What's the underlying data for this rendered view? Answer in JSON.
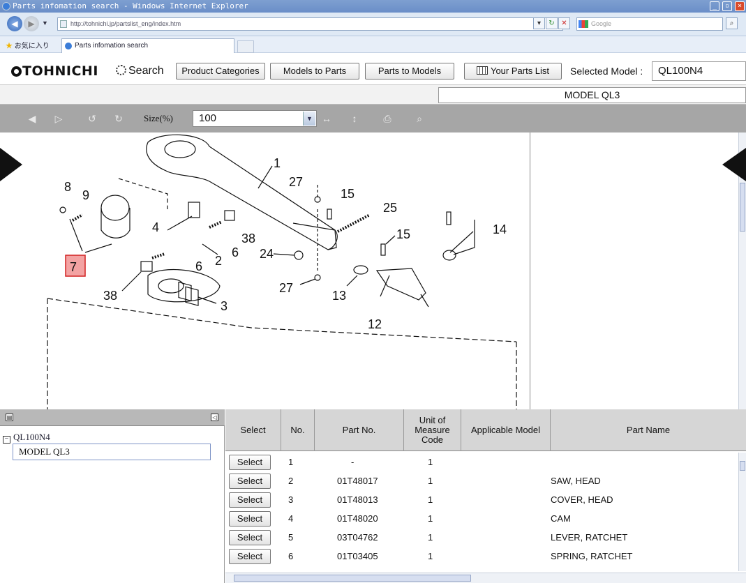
{
  "browser": {
    "window_title": "Parts infomation search - Windows Internet Explorer",
    "url": "http://tohnichi.jp/partslist_eng/index.htm",
    "search_engine": "Google",
    "favorites_label": "お気に入り",
    "tab_title": "Parts infomation search"
  },
  "header": {
    "logo": "TOHNICHI",
    "search_label": "Search",
    "buttons": {
      "product_categories": "Product Categories",
      "models_to_parts": "Models to Parts",
      "parts_to_models": "Parts to Models",
      "your_parts_list": "Your Parts List"
    },
    "selected_model_label": "Selected Model :",
    "selected_model_value": "QL100N4",
    "model_title": "MODEL QL3"
  },
  "viewer": {
    "size_label": "Size(%)",
    "size_value": "100",
    "part_labels": {
      "p1": "1",
      "p2": "2",
      "p3": "3",
      "p4": "4",
      "p6a": "6",
      "p6b": "6",
      "p7": "7",
      "p8": "8",
      "p9": "9",
      "p12": "12",
      "p13": "13",
      "p14": "14",
      "p15a": "15",
      "p15b": "15",
      "p24": "24",
      "p25": "25",
      "p27a": "27",
      "p27b": "27",
      "p38a": "38",
      "p38b": "38"
    },
    "highlighted_part": "7"
  },
  "tree": {
    "root": "QL100N4",
    "child": "MODEL QL3"
  },
  "chart_data": {
    "type": "table",
    "columns": [
      "Select",
      "No.",
      "Part No.",
      "Unit of Measure Code",
      "Applicable Model",
      "Part Name"
    ],
    "rows": [
      {
        "select": "Select",
        "no": "1",
        "part_no": "-",
        "uom": "1",
        "model": "",
        "name": ""
      },
      {
        "select": "Select",
        "no": "2",
        "part_no": "01T48017",
        "uom": "1",
        "model": "",
        "name": "SAW, HEAD"
      },
      {
        "select": "Select",
        "no": "3",
        "part_no": "01T48013",
        "uom": "1",
        "model": "",
        "name": "COVER, HEAD"
      },
      {
        "select": "Select",
        "no": "4",
        "part_no": "01T48020",
        "uom": "1",
        "model": "",
        "name": "CAM"
      },
      {
        "select": "Select",
        "no": "5",
        "part_no": "03T04762",
        "uom": "1",
        "model": "",
        "name": "LEVER, RATCHET"
      },
      {
        "select": "Select",
        "no": "6",
        "part_no": "01T03405",
        "uom": "1",
        "model": "",
        "name": "SPRING, RATCHET"
      }
    ]
  },
  "colors": {
    "titlebar": "#6a8ec8",
    "toolbar": "#a6a6a6",
    "highlight_fill": "#f3a3a3",
    "highlight_border": "#d22222",
    "table_header": "#d6d6d6"
  }
}
